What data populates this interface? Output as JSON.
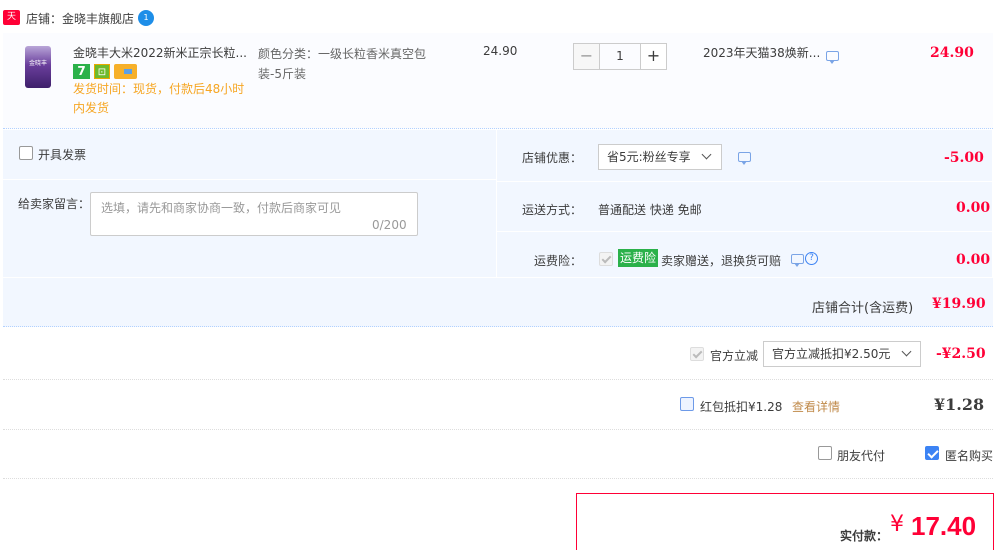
{
  "shop": {
    "platform_badge": "天猫",
    "title": "店铺：金晓丰旗舰店",
    "ww_badge": "1"
  },
  "item": {
    "thumb_label": "金晓丰",
    "title": "金晓丰大米2022新米正宗长粒...",
    "badge_7": "7",
    "badge_shield": "⊡",
    "ship_time": "发货时间：现货，付款后48小时内发货",
    "sku": "颜色分类：一级长粒香米真空包装-5斤装",
    "unit_price": "24.90",
    "quantity": "1",
    "minus": "−",
    "plus": "+",
    "promotion": "2023年天猫38焕新...",
    "total": "24.90"
  },
  "options": {
    "invoice_label": "开具发票",
    "message_label": "给卖家留言：",
    "message_placeholder": "选填，请先和商家协商一致，付款后商家可见",
    "message_count": "0/200",
    "shop_discount_label": "店铺优惠：",
    "shop_discount_value": "省5元:粉丝专享",
    "shop_discount_amount": "-5.00",
    "shipping_label": "运送方式：",
    "shipping_value": "普通配送 快递 免邮",
    "shipping_amount": "0.00",
    "insurance_label": "运费险：",
    "insurance_badge": "运费险",
    "insurance_value": "卖家赠送，退换货可赔",
    "insurance_amount": "0.00",
    "help": "?",
    "shop_total_label": "店铺合计(含运费)",
    "shop_total_value": "¥19.90"
  },
  "official": {
    "label": "官方立减",
    "select_value": "官方立减抵扣¥2.50元",
    "amount": "-¥2.50"
  },
  "redpacket": {
    "label": "红包抵扣¥1.28",
    "detail_link": "查看详情",
    "amount": "¥1.28"
  },
  "flags": {
    "friend_pay": "朋友代付",
    "anonymous": "匿名购买"
  },
  "payment": {
    "label": "实付款：",
    "currency": "¥",
    "amount": "17.40"
  },
  "colors": {
    "accent_red": "#ff0036",
    "blue": "#3c83f4",
    "green": "#2bb14a"
  }
}
